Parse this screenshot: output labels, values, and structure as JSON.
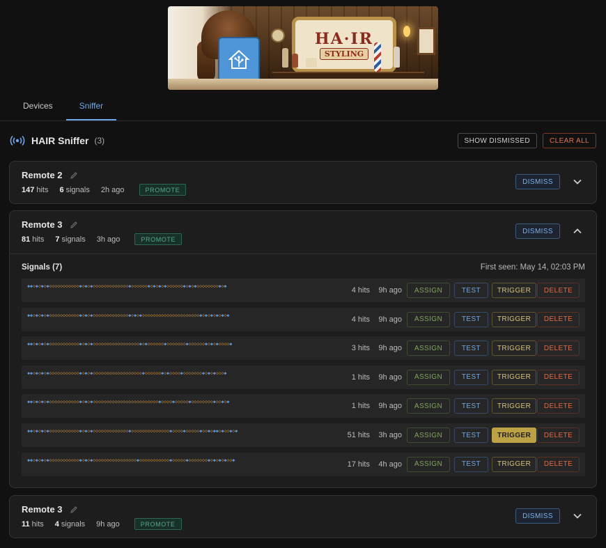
{
  "banner": {
    "sign_title": "HA·IR",
    "sign_subtitle": "STYLING"
  },
  "tabs": [
    {
      "label": "Devices",
      "active": false
    },
    {
      "label": "Sniffer",
      "active": true
    }
  ],
  "header": {
    "title": "HAIR Sniffer",
    "count": "(3)",
    "show_dismissed": "SHOW DISMISSED",
    "clear_all": "CLEAR ALL"
  },
  "colors": {
    "accent": "#6ea6ea",
    "background": "#111111",
    "card": "#1d1d1d",
    "promote": "#58a888",
    "assign": "#7fa65a",
    "trigger": "#d8c37a",
    "delete": "#e06a45"
  },
  "labels": {
    "promote": "PROMOTE",
    "dismiss": "DISMISS",
    "assign": "ASSIGN",
    "test": "TEST",
    "trigger": "TRIGGER",
    "delete": "DELETE"
  },
  "remotes": [
    {
      "name": "Remote 2",
      "hits": "147",
      "hits_label": "hits",
      "signals": "6",
      "signals_label": "signals",
      "ago": "2h ago",
      "expanded": false
    },
    {
      "name": "Remote 3",
      "hits": "81",
      "hits_label": "hits",
      "signals": "7",
      "signals_label": "signals",
      "ago": "3h ago",
      "expanded": true,
      "signals_title": "Signals (7)",
      "first_seen": "First seen: May 14, 02:03 PM",
      "signal_rows": [
        {
          "code": "◆◆◇◆◇◆◇◆◇◇◇◇◇◇◇◇◇◇◇◆◇◆◇◆◇◇◇◇◇◇◇◇◇◇◇◇◇◆◇◇◇◇◇◇◆◇◆◇◆◇◆◇◇◇◇◇◇◆◇◆◇◆◇◇◇◇◇◇◇◇◆◇◆",
          "hits": "4 hits",
          "ago": "9h ago",
          "trigger_active": false
        },
        {
          "code": "◆◆◇◆◇◆◇◆◇◇◇◇◇◇◇◇◇◇◇◆◇◆◇◆◇◇◇◇◇◇◇◇◇◇◇◇◇◆◇◆◇◆◇◇◇◇◇◇◇◇◇◇◇◇◇◇◇◇◇◇◇◇◇◆◇◆◇◆◇◆◇◆◇◆",
          "hits": "4 hits",
          "ago": "9h ago",
          "trigger_active": false
        },
        {
          "code": "◆◆◇◆◇◆◇◆◇◇◇◇◇◇◇◇◇◇◇◆◇◆◇◆◇◇◇◇◇◇◇◇◇◇◇◇◇◇◇◇◇◆◇◆◇◇◇◇◇◇◆◇◇◇◇◇◇◇◆◇◇◇◇◇◇◆◇◆◇◆◇◇◇◇◆",
          "hits": "3 hits",
          "ago": "9h ago",
          "trigger_active": false
        },
        {
          "code": "◆◆◇◆◇◆◇◆◇◇◇◇◇◇◇◇◇◇◇◆◇◆◇◆◇◇◇◇◇◇◇◇◇◇◇◇◇◇◇◇◇◇◆◇◇◇◇◇◇◆◇◆◇◇◇◇◆◇◇◇◇◇◇◇◆◇◆◇◆◇◇◇◆",
          "hits": "1 hits",
          "ago": "9h ago",
          "trigger_active": false
        },
        {
          "code": "◆◆◇◆◇◆◇◆◇◇◇◇◇◇◇◇◇◇◇◆◇◆◇◆◇◇◇◇◇◇◇◇◇◇◇◇◇◇◇◇◇◇◇◇◇◇◇◇◆◇◇◇◇◆◇◇◇◇◇◆◇◇◇◇◇◇◇◇◆◇◇◆◇◆",
          "hits": "1 hits",
          "ago": "9h ago",
          "trigger_active": false
        },
        {
          "code": "◆◆◇◆◇◆◇◆◇◇◇◇◇◇◇◇◇◇◇◆◇◆◇◆◇◇◇◇◇◇◇◇◇◇◇◇◇◆◇◇◇◇◇◇◇◇◇◇◇◇◇◇◆◇◇◇◇◆◇◇◇◇◇◆◇◇◆◇◆◆◇◆◇◇◆◇◆",
          "hits": "51 hits",
          "ago": "3h ago",
          "trigger_active": true
        },
        {
          "code": "◆◆◇◆◇◆◇◆◇◇◇◇◇◇◇◇◇◇◇◆◇◆◇◆◇◇◇◇◇◇◇◇◇◇◇◇◇◇◇◇◆◇◇◇◇◇◇◇◇◇◇◇◆◇◇◇◇◇◆◇◇◇◇◇◇◇◆◇◆◇◆◇◆◇◇◆",
          "hits": "17 hits",
          "ago": "4h ago",
          "trigger_active": false
        }
      ]
    },
    {
      "name": "Remote 3",
      "hits": "11",
      "hits_label": "hits",
      "signals": "4",
      "signals_label": "signals",
      "ago": "9h ago",
      "expanded": false
    }
  ]
}
